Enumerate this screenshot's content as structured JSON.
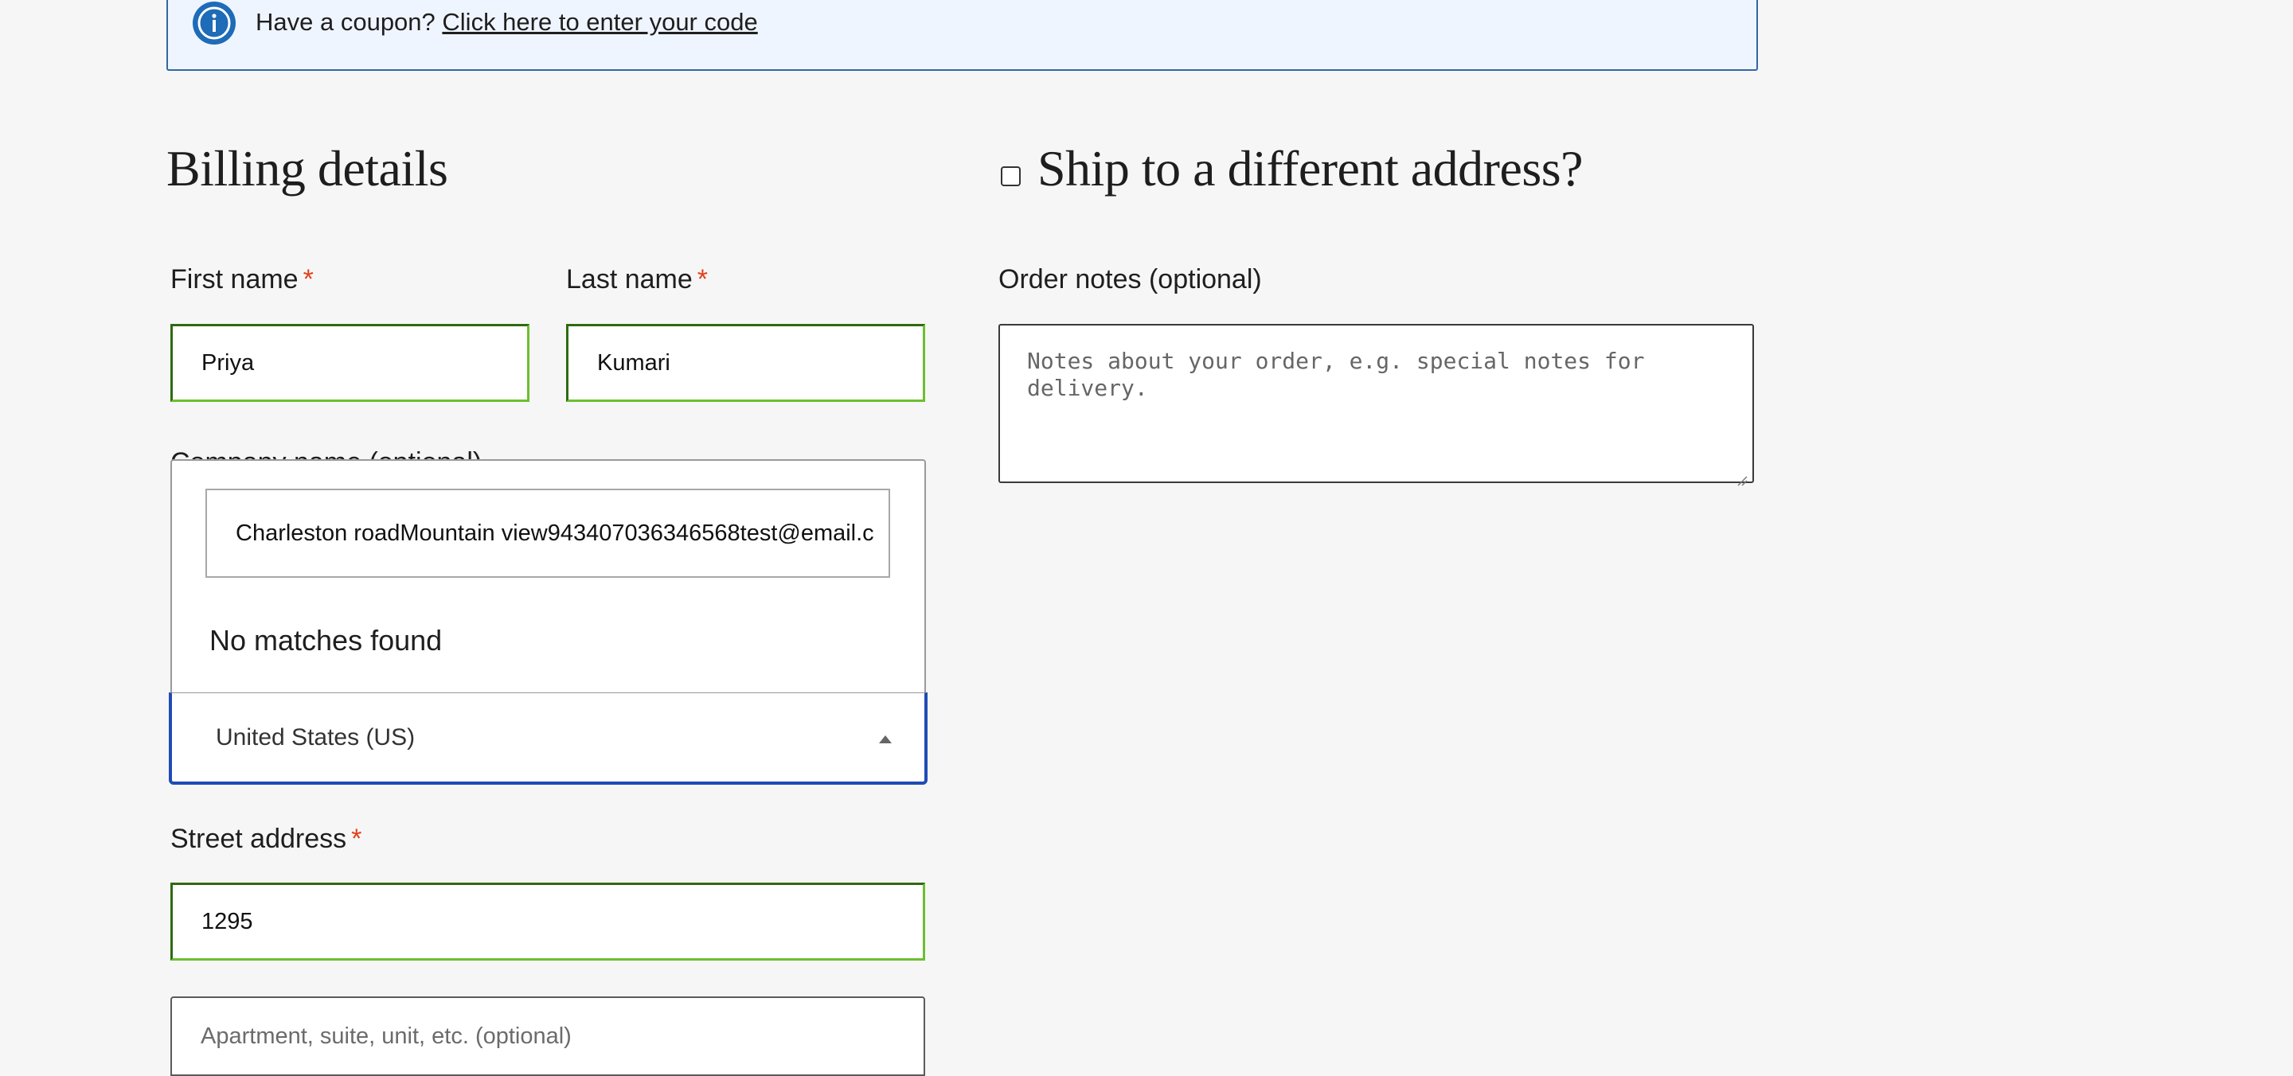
{
  "notice": {
    "icon": "info-icon",
    "text": "Have a coupon?",
    "link": "Click here to enter your code",
    "colors": {
      "background": "#eff5ff",
      "border": "#3167a5",
      "icon": "#1e6bb8"
    }
  },
  "billing": {
    "heading": "Billing details",
    "first_name": {
      "label": "First name",
      "required_mark": "*",
      "value": "Priya"
    },
    "last_name": {
      "label": "Last name",
      "required_mark": "*",
      "value": "Kumari"
    },
    "company": {
      "label": "Company name (optional)"
    },
    "country": {
      "selected": "United States (US)",
      "search_value": "Charleston roadMountain view943407036346568test@email.c",
      "no_results": "No matches found"
    },
    "street": {
      "label": "Street address",
      "required_mark": "*",
      "value": "1295",
      "apartment_placeholder": "Apartment, suite, unit, etc. (optional)"
    }
  },
  "shipping": {
    "heading": "Ship to a different address?",
    "checked": false,
    "order_notes": {
      "label": "Order notes (optional)",
      "placeholder": "Notes about your order, e.g. special notes for delivery."
    }
  },
  "colors": {
    "required": "#e2401c",
    "valid_border": "#6cbf2f",
    "focus_border": "#1f4bb5"
  }
}
